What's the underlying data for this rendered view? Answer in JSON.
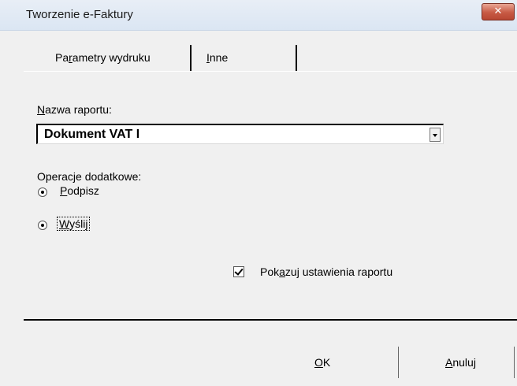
{
  "window": {
    "title": "Tworzenie e-Faktury",
    "close_glyph": "✕"
  },
  "tabs": [
    {
      "prefix": "Pa",
      "accel": "r",
      "suffix": "ametry wydruku"
    },
    {
      "prefix": "",
      "accel": "I",
      "suffix": "nne"
    }
  ],
  "report": {
    "label_accel": "N",
    "label_rest": "azwa raportu:",
    "selected": "Dokument VAT I"
  },
  "operations": {
    "label": "Operacje dodatkowe:",
    "options": [
      {
        "accel": "P",
        "rest": "odpisz",
        "selected": true
      },
      {
        "accel": "W",
        "rest": "yślij",
        "selected": true
      }
    ]
  },
  "show_settings": {
    "prefix": "Pok",
    "accel": "a",
    "suffix": "zuj ustawienia raportu",
    "checked": true
  },
  "buttons": {
    "ok": {
      "accel": "O",
      "rest": "K"
    },
    "cancel": {
      "accel": "A",
      "rest": "nuluj"
    }
  },
  "icons": {
    "close": "close-icon",
    "dropdown": "chevron-down-icon"
  }
}
